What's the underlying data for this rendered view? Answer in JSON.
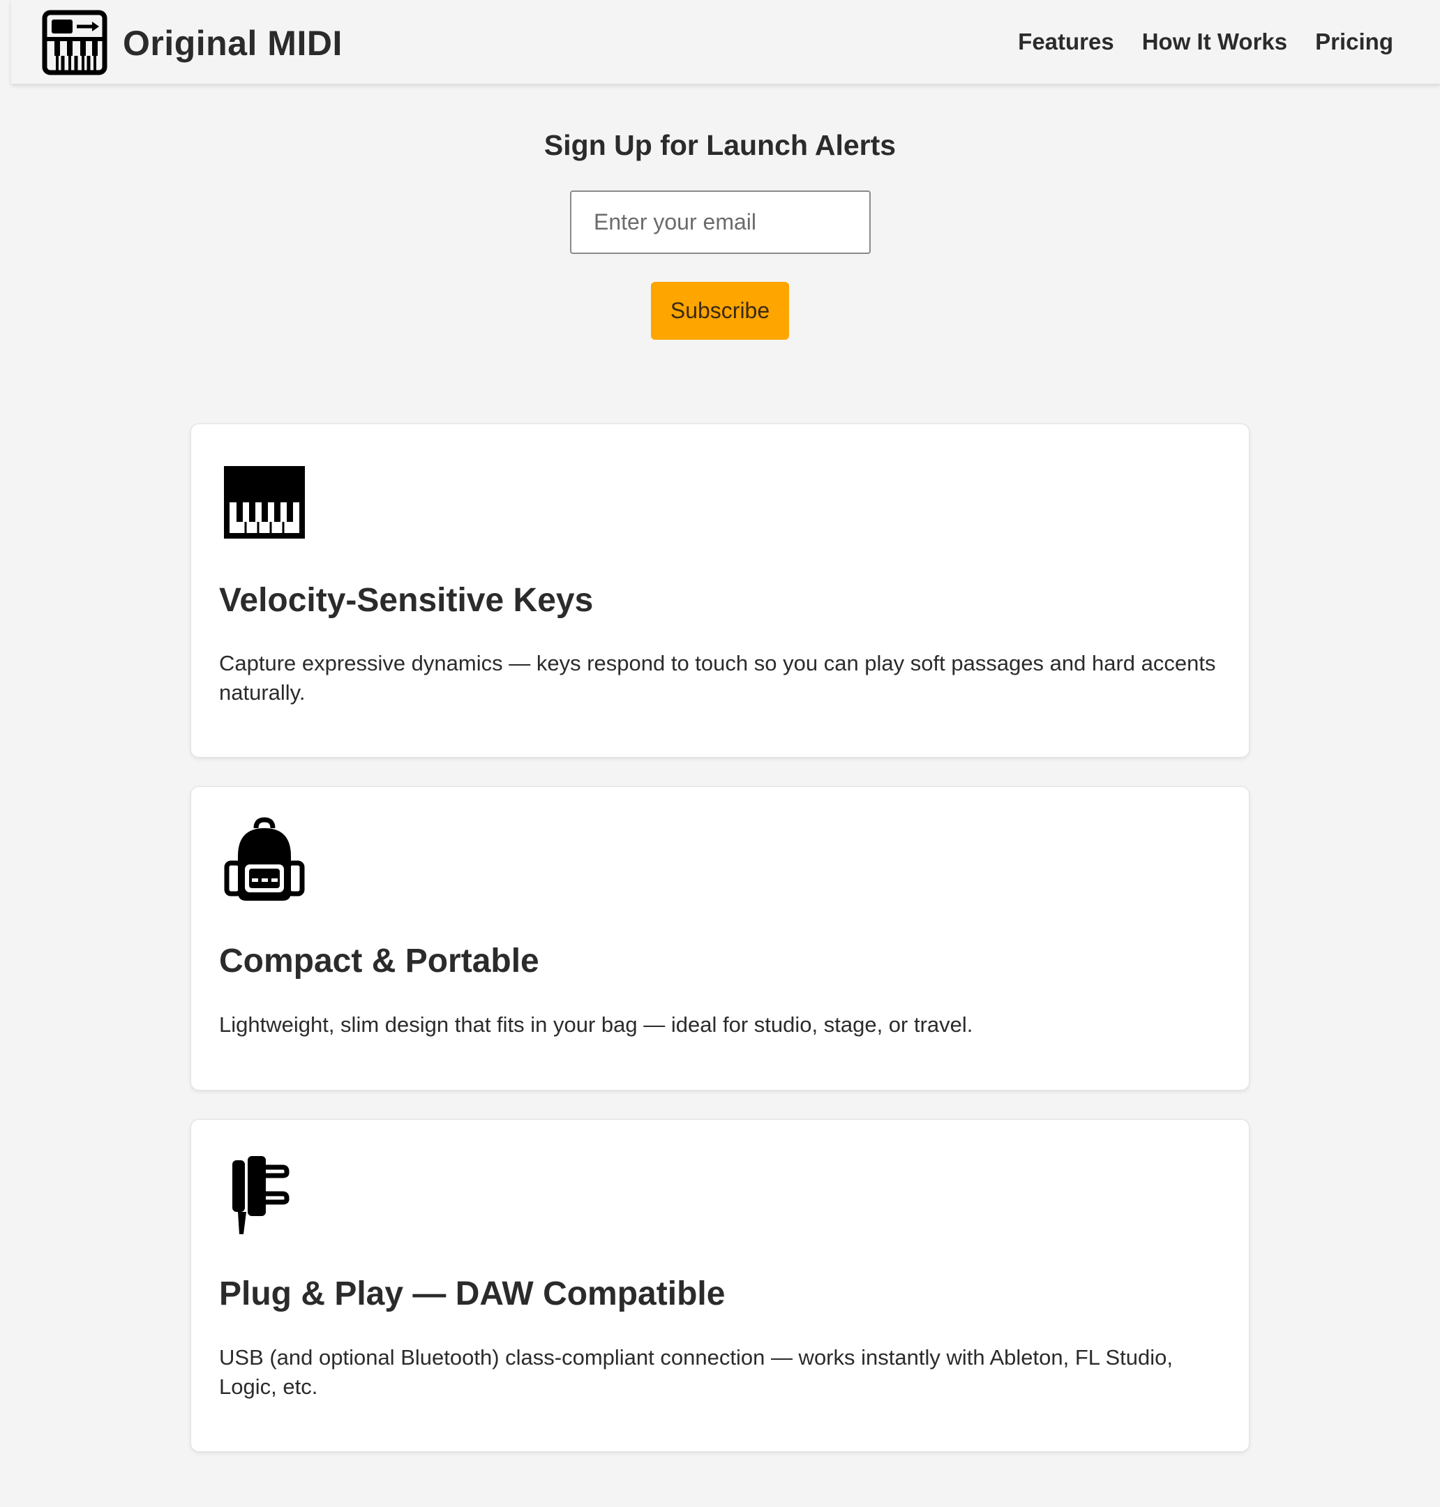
{
  "header": {
    "brand": "Original MIDI",
    "nav": {
      "features": "Features",
      "how_it_works": "How It Works",
      "pricing": "Pricing"
    }
  },
  "signup": {
    "title": "Sign Up for Launch Alerts",
    "email_placeholder": "Enter your email",
    "email_value": "",
    "subscribe_label": "Subscribe",
    "accent_color": "#ffa500"
  },
  "features": [
    {
      "icon": "piano-keys-icon",
      "title": "Velocity-Sensitive Keys",
      "description": "Capture expressive dynamics — keys respond to touch so you can play soft passages and hard accents naturally."
    },
    {
      "icon": "backpack-icon",
      "title": "Compact & Portable",
      "description": "Lightweight, slim design that fits in your bag — ideal for studio, stage, or travel."
    },
    {
      "icon": "plug-icon",
      "title": "Plug & Play — DAW Compatible",
      "description": "USB (and optional Bluetooth) class-compliant connection — works instantly with Ableton, FL Studio, Logic, etc."
    }
  ]
}
